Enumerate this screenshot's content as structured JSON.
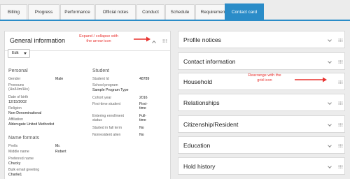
{
  "tabs": [
    {
      "label": "Billing"
    },
    {
      "label": "Progress"
    },
    {
      "label": "Performance"
    },
    {
      "label": "Official notes"
    },
    {
      "label": "Conduct"
    },
    {
      "label": "Schedule"
    },
    {
      "label": "Requirements"
    },
    {
      "label": "Contact card",
      "active": true
    }
  ],
  "general": {
    "title": "General information",
    "edit_label": "Edit",
    "annotation": "Expand / collapse with\nthe arrow icon",
    "personal": {
      "heading": "Personal",
      "fields": [
        {
          "label": "Gender",
          "value": "Male"
        },
        {
          "label": "Pronouns\n(He/Him/His)",
          "value": ""
        },
        {
          "label": "Date of birth",
          "value": "12/15/2002"
        },
        {
          "label": "Religion",
          "value": "Non-Denominational"
        },
        {
          "label": "Affiliation",
          "value": "Aldersgate United Methodist"
        }
      ]
    },
    "name_formats": {
      "heading": "Name formats",
      "fields": [
        {
          "label": "Prefix",
          "value": "Mr."
        },
        {
          "label": "Middle name",
          "value": "Robert"
        },
        {
          "label": "Preferred name",
          "value": "Chucky"
        },
        {
          "label": "Bulk email greeting",
          "value": "Charlie1"
        }
      ]
    },
    "student": {
      "heading": "Student",
      "fields": [
        {
          "label": "Student Id",
          "value": "48789"
        },
        {
          "label": "School program",
          "value": "Sample Program Type"
        },
        {
          "label": "Cohort year",
          "value": "2016"
        },
        {
          "label": "First-time student",
          "value": "First-\ntime"
        },
        {
          "label": "Entering enrollment\nstatus",
          "value": "Full-\ntime"
        },
        {
          "label": "Started in fall term",
          "value": "No"
        },
        {
          "label": "Nonresident alien",
          "value": "No"
        }
      ]
    }
  },
  "right_panels": [
    {
      "title": "Profile notices"
    },
    {
      "title": "Contact information"
    },
    {
      "title": "Household"
    },
    {
      "title": "Relationships"
    },
    {
      "title": "Citizenship/Resident"
    },
    {
      "title": "Education"
    },
    {
      "title": "Hold history"
    }
  ],
  "household_annotation": "Rearrange with the\ngrid icon",
  "colors": {
    "accent": "#2a8cc8",
    "annotation": "#e8322f"
  }
}
